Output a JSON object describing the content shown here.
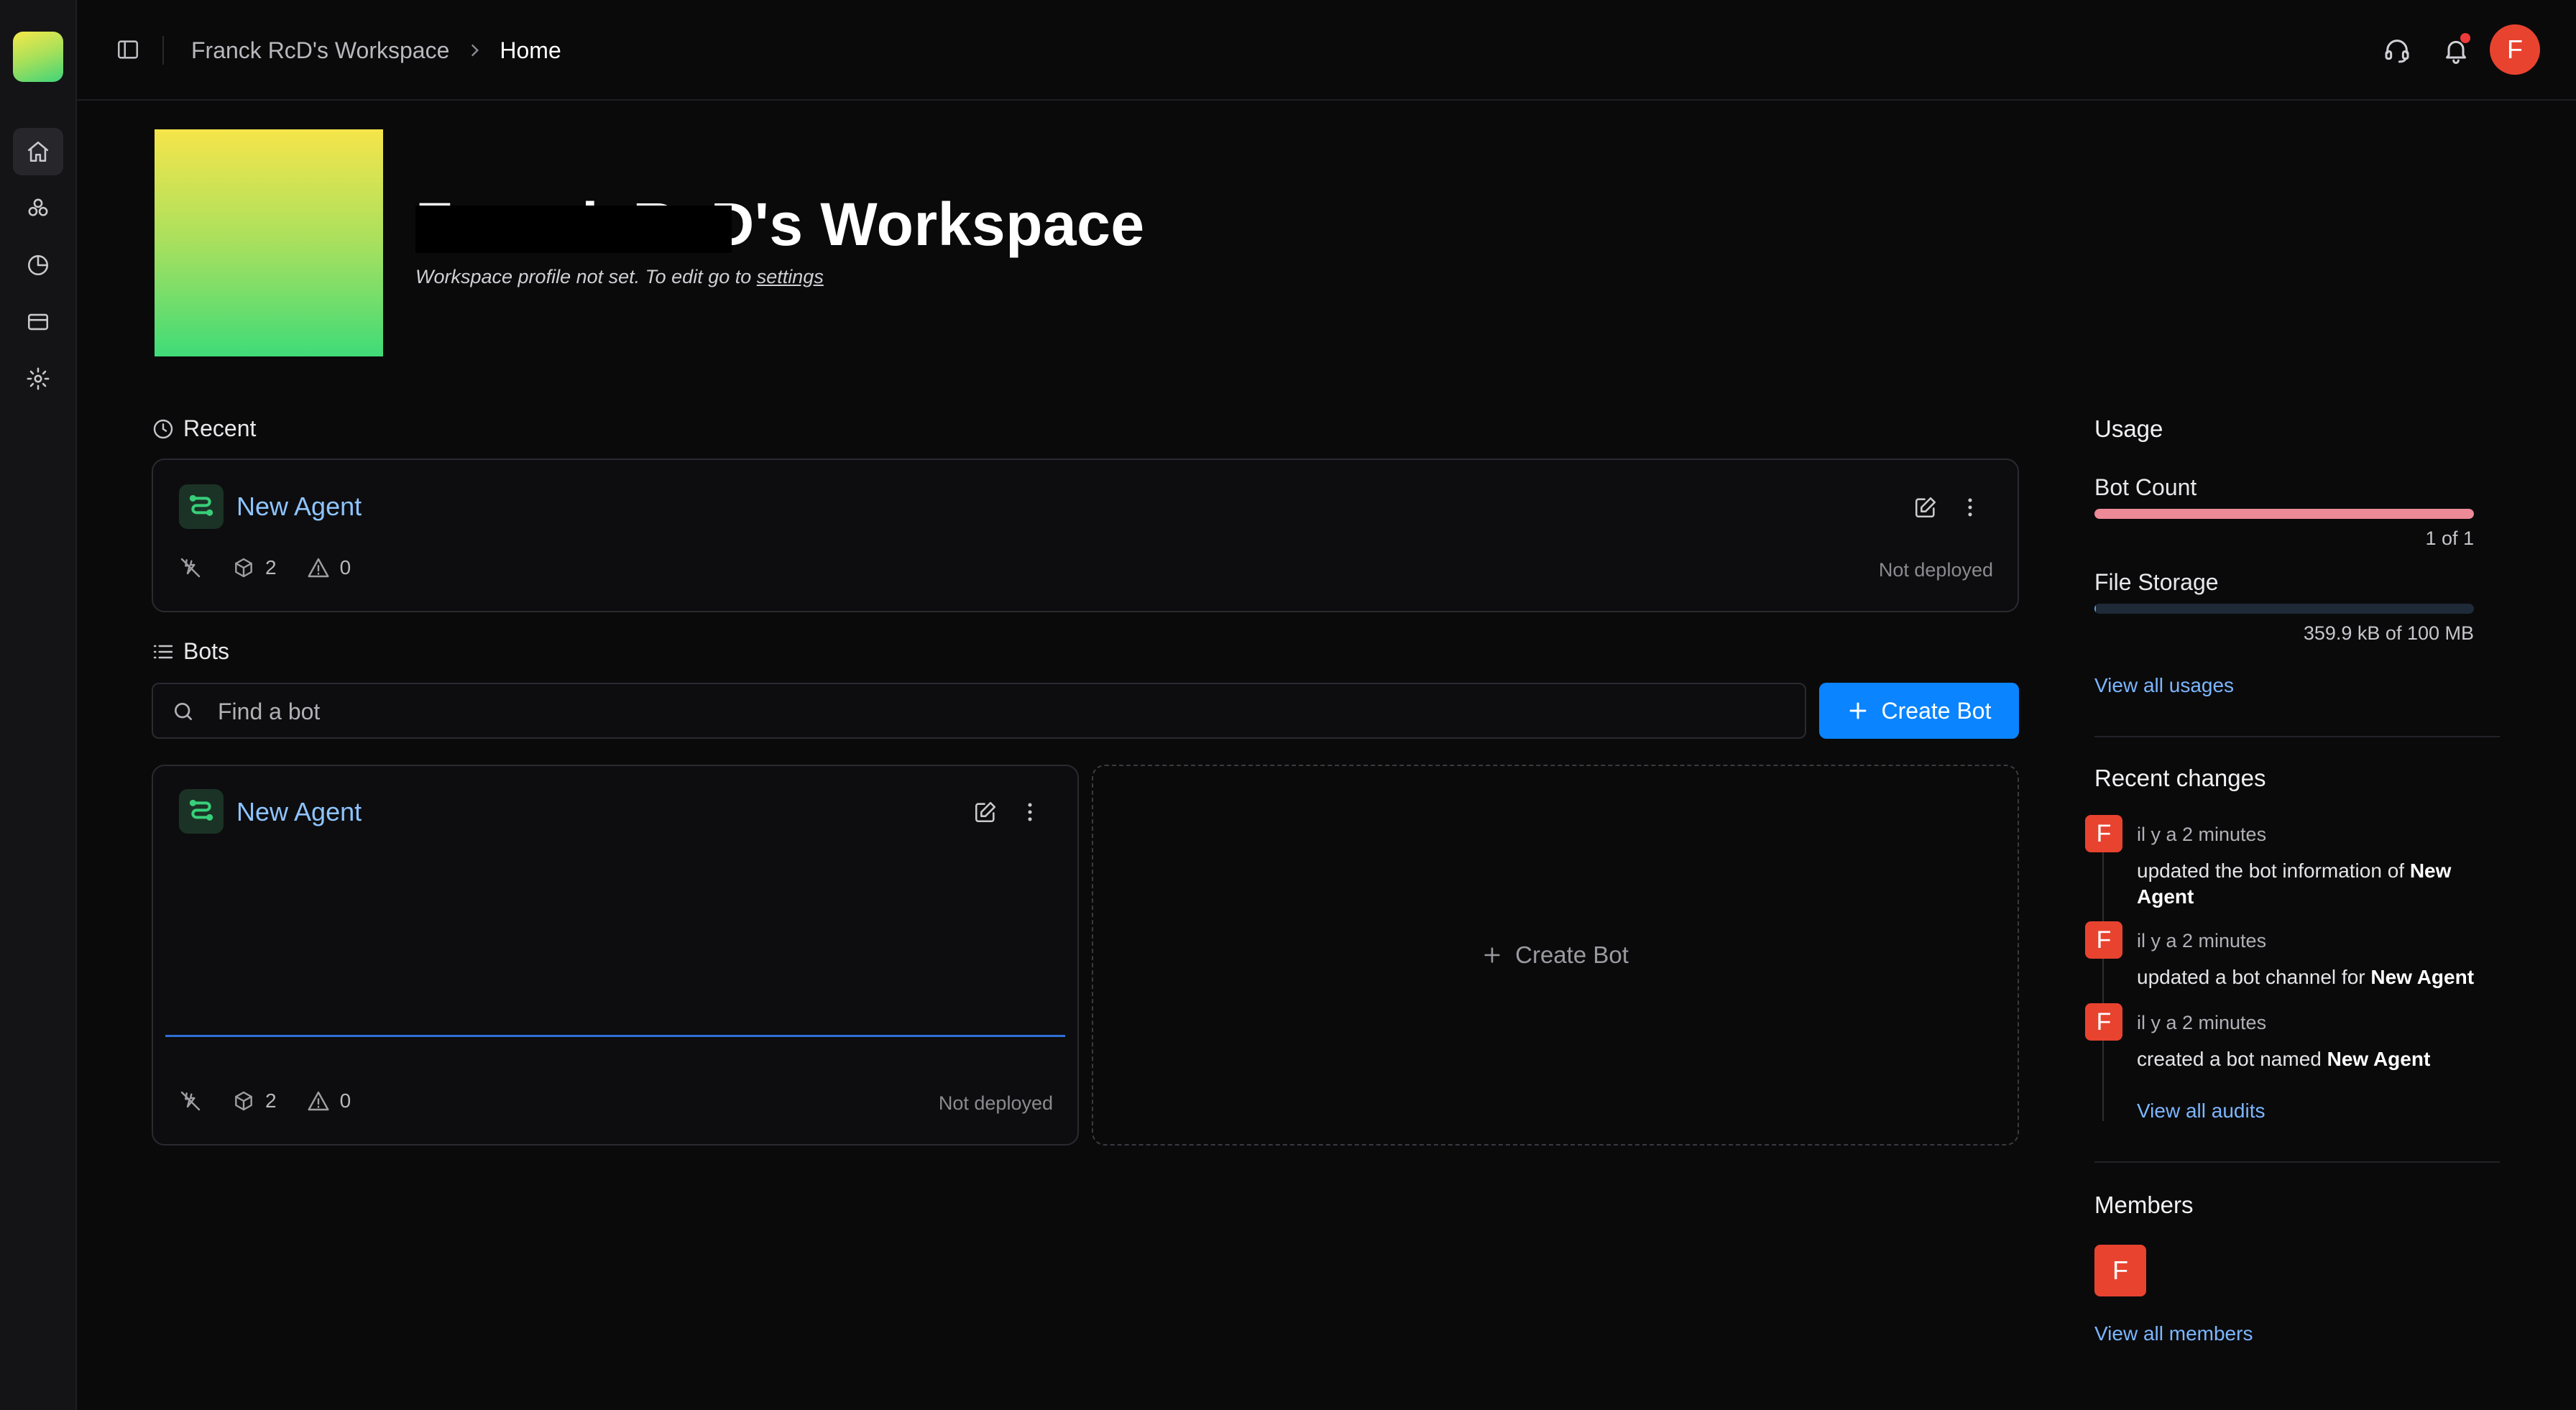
{
  "breadcrumb": {
    "workspace": "Franck RcD's Workspace",
    "current": "Home"
  },
  "user": {
    "initial": "F"
  },
  "colors": {
    "accent": "#0a84ff",
    "avatar": "#e8432f",
    "bot_icon": "#37d07a",
    "link": "#7cb6ff",
    "bot_count_bar": "#ec8a97",
    "file_storage_bar": "#5b9bd5"
  },
  "nav": {
    "items": [
      {
        "name": "home",
        "icon": "home-icon"
      },
      {
        "name": "integrations",
        "icon": "integrations-icon"
      },
      {
        "name": "usage",
        "icon": "pie-chart-icon"
      },
      {
        "name": "billing",
        "icon": "credit-card-icon"
      },
      {
        "name": "settings",
        "icon": "gear-icon"
      }
    ]
  },
  "workspace": {
    "title": "Franck RcD's Workspace",
    "subtitle_prefix": "Workspace profile not set. To edit go to ",
    "subtitle_link": "settings"
  },
  "recent": {
    "label": "Recent",
    "card": {
      "name": "New Agent",
      "count": "2",
      "warnings": "0",
      "status": "Not deployed"
    }
  },
  "bots": {
    "label": "Bots",
    "search_placeholder": "Find a bot",
    "create_label": "Create Bot",
    "items": [
      {
        "name": "New Agent",
        "count": "2",
        "warnings": "0",
        "status": "Not deployed"
      }
    ],
    "create_card_label": "Create Bot"
  },
  "usage": {
    "title": "Usage",
    "bot_count": {
      "label": "Bot Count",
      "value": "1 of 1",
      "fraction": 1.0
    },
    "file_storage": {
      "label": "File Storage",
      "value": "359.9 kB of 100 MB",
      "fraction": 0.0036
    },
    "view_all": "View all usages"
  },
  "recent_changes": {
    "title": "Recent changes",
    "items": [
      {
        "initial": "F",
        "time": "il y a 2 minutes",
        "text": "updated the bot information of ",
        "target": "New Agent"
      },
      {
        "initial": "F",
        "time": "il y a 2 minutes",
        "text": "updated a bot channel for ",
        "target": "New Agent"
      },
      {
        "initial": "F",
        "time": "il y a 2 minutes",
        "text": "created a bot named ",
        "target": "New Agent"
      }
    ],
    "view_all": "View all audits"
  },
  "members": {
    "title": "Members",
    "items": [
      {
        "initial": "F"
      }
    ],
    "view_all": "View all members"
  }
}
